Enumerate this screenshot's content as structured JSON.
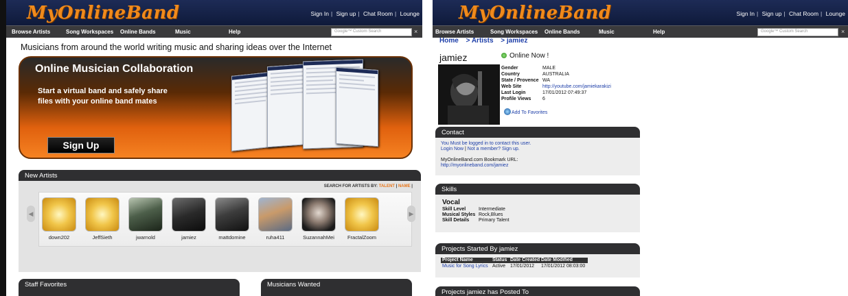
{
  "site": {
    "logo": "MyOnlineBand",
    "top_links": [
      "Sign In",
      "Sign up",
      "Chat Room",
      "Lounge"
    ],
    "nav": [
      "Browse Artists",
      "Song Workspaces",
      "Online Bands",
      "Music",
      "Help"
    ],
    "search_placeholder": "Google™ Custom Search",
    "search_clear": "×"
  },
  "home": {
    "tagline": "Musicians from around the world writing music and sharing ideas over the Internet",
    "hero": {
      "title": "Online Musician Collaboration",
      "text": "Start a virtual band and safely share files with your online band mates",
      "button": "Sign Up"
    },
    "new_artists": {
      "title": "New Artists",
      "search_by_label": "SEARCH FOR ARTISTS BY:",
      "search_options": [
        "TALENT",
        "NAME"
      ],
      "prev_arrow": "◀",
      "next_arrow": "▶",
      "artists": [
        "down202",
        "JeffSieth",
        "jwarnold",
        "jamiez",
        "mattdomine",
        "ruha411",
        "SuzannahMei",
        "FractalZoom"
      ]
    },
    "staff_favorites_title": "Staff Favorites",
    "musicians_wanted_title": "Musicians Wanted"
  },
  "profile": {
    "breadcrumb": [
      "Home",
      "> Artists",
      "> jamiez"
    ],
    "username": "jamiez",
    "status": "Online Now !",
    "fields": [
      {
        "k": "Gender",
        "v": "MALE"
      },
      {
        "k": "Country",
        "v": "AUSTRALIA"
      },
      {
        "k": "State / Provence",
        "v": "WA"
      },
      {
        "k": "Web Site",
        "v": "http://youtube.com/jamiekarakizi"
      },
      {
        "k": "Last Login",
        "v": "17/01/2012 07:49:37"
      },
      {
        "k": "Profile Views",
        "v": "6"
      }
    ],
    "add_favorites": "Add To Favorites",
    "contact": {
      "title": "Contact",
      "line1": "You Must be logged in to contact this user.",
      "login": "Login Now",
      "not_member": "Not a member? Sign up.",
      "bookmark_label": "MyOnlineBand.com Bookmark URL:",
      "bookmark_url": "http://myonlineband.com/jamiez"
    },
    "skills": {
      "title": "Skills",
      "name": "Vocal",
      "level_k": "Skill Level",
      "level_v": "Intermediate",
      "styles_k": "Musical Styles",
      "styles_v": "Rock,Blues",
      "details_k": "Skill Details",
      "details_v": "Primary Talent"
    },
    "projects": {
      "title": "Projects Started By jamiez",
      "headers": [
        "Project Name",
        "Status",
        "Date Created",
        "Date Modified"
      ],
      "rows": [
        [
          "Music for Song Lyrics",
          "Active",
          "17/01/2012",
          "17/01/2012 08:03:00"
        ]
      ]
    },
    "posted_title": "Projects jamiez has Posted To"
  }
}
